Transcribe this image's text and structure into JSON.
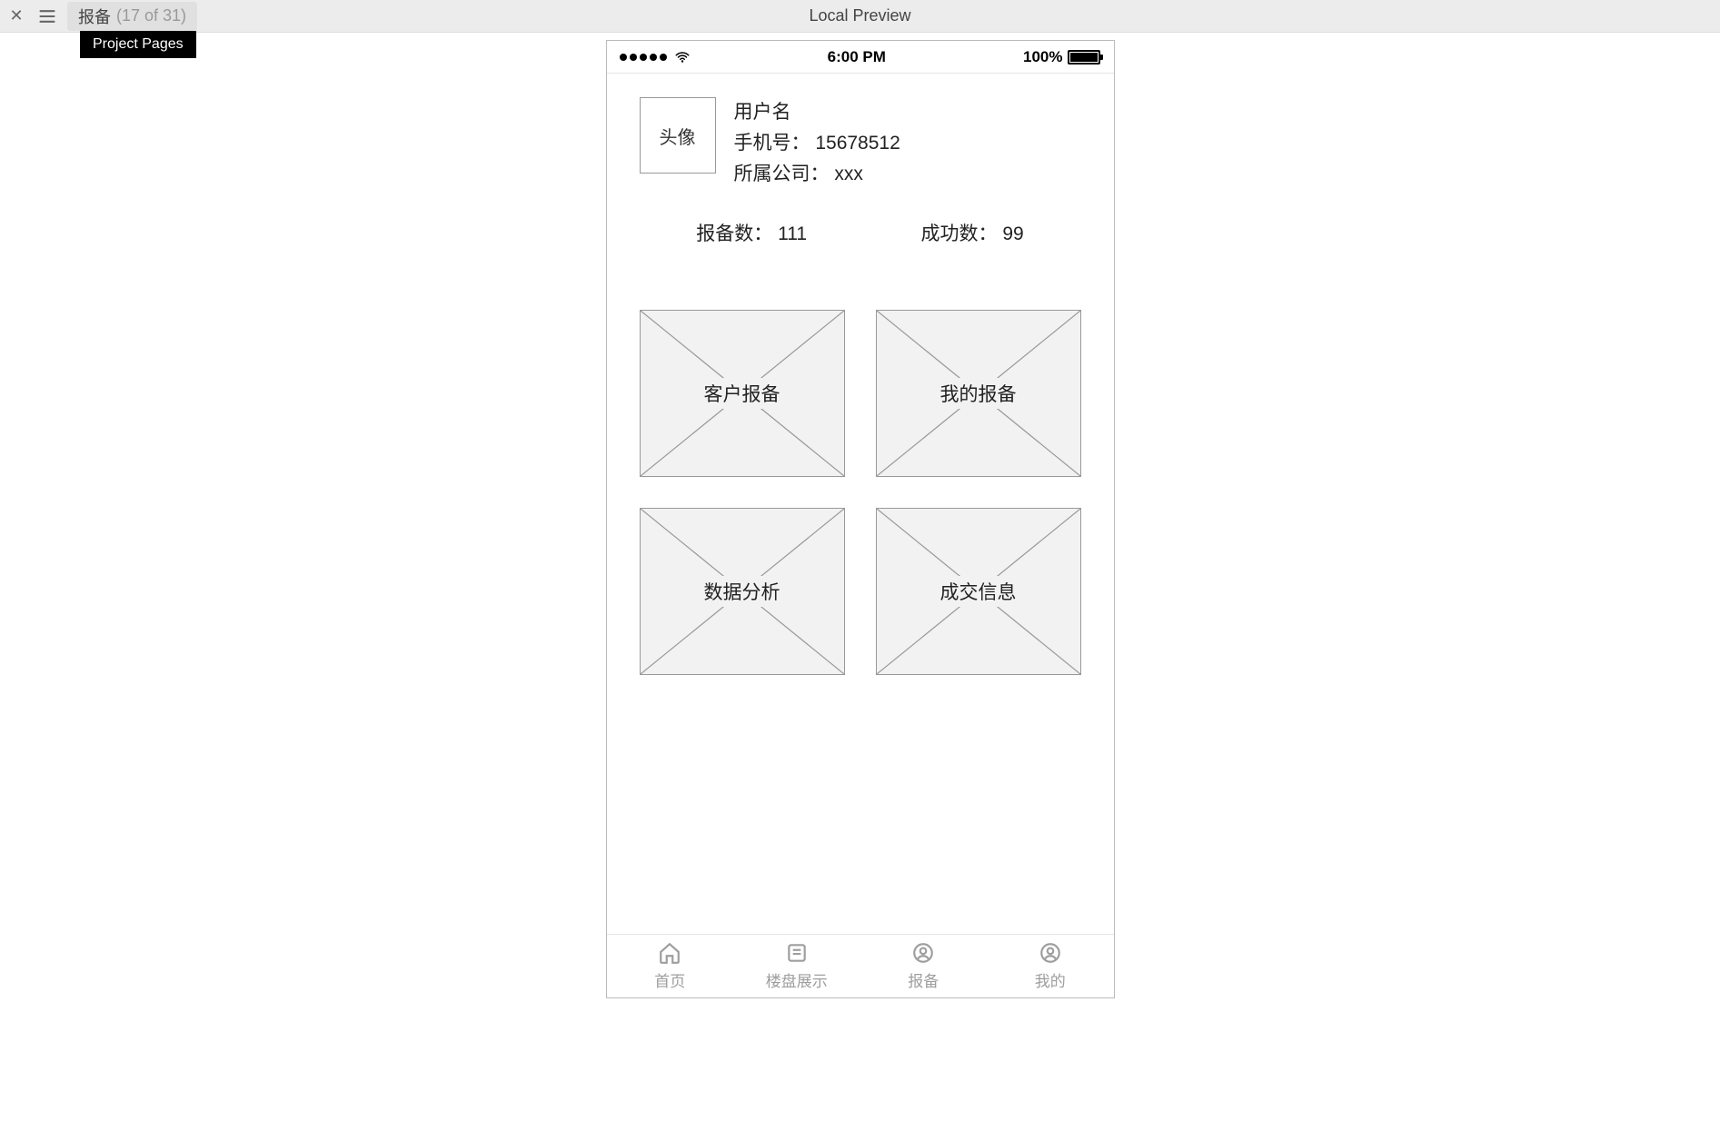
{
  "topbar": {
    "tab_title": "报备",
    "tab_counter": "(17 of 31)",
    "preview_label": "Local Preview",
    "tooltip": "Project Pages"
  },
  "phone": {
    "status": {
      "time": "6:00 PM",
      "battery_text": "100%"
    },
    "profile": {
      "avatar_label": "头像",
      "username": "用户名",
      "phone_label": "手机号：",
      "phone_value": "15678512",
      "company_label": "所属公司：",
      "company_value": "xxx"
    },
    "stats": {
      "report_label": "报备数：",
      "report_value": "111",
      "success_label": "成功数：",
      "success_value": "99"
    },
    "tiles": [
      {
        "label": "客户报备"
      },
      {
        "label": "我的报备"
      },
      {
        "label": "数据分析"
      },
      {
        "label": "成交信息"
      }
    ],
    "nav": [
      {
        "label": "首页"
      },
      {
        "label": "楼盘展示"
      },
      {
        "label": "报备"
      },
      {
        "label": "我的"
      }
    ]
  }
}
